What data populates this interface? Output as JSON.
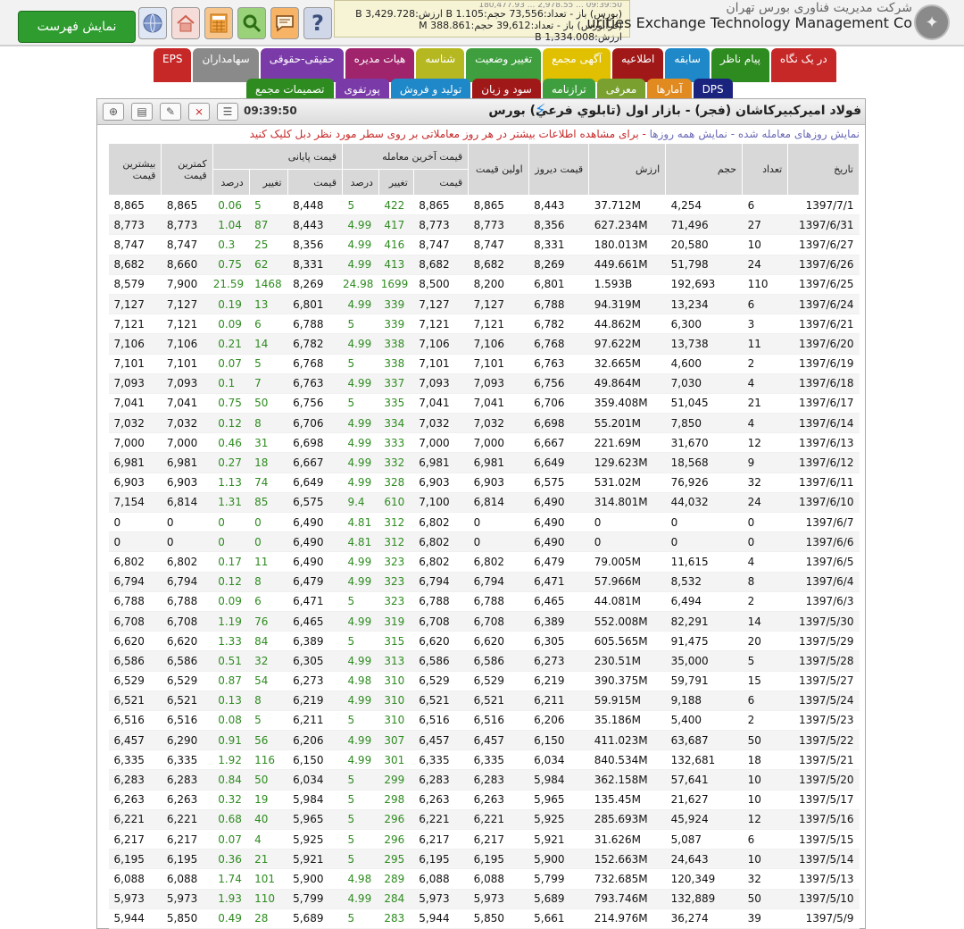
{
  "header": {
    "show_list_label": "نمایش فهرست",
    "company_fa": "شرکت مدیریت فناوری بورس تهران",
    "company_en": "urities Exchange Technology Management Co",
    "ticker_line_faint": "09:39:50 ... 2,978.55 ... 180,477.93",
    "ticker_line1": "(بورس) باز - تعداد:73,556 حجم:1.105 B ارزش:3,429.728 B",
    "ticker_line2": "(فرابورس) باز - تعداد:39,612 حجم:388.861 M ارزش:1,334.008 B",
    "icons": [
      "globe-icon",
      "home-icon",
      "calculator-icon",
      "search-icon",
      "message-icon",
      "help-icon"
    ]
  },
  "tabs_row1": [
    {
      "label": "در یک نگاه",
      "color": "#c62828"
    },
    {
      "label": "پیام ناظر",
      "color": "#2e8b20"
    },
    {
      "label": "سابقه",
      "color": "#1e88c8"
    },
    {
      "label": "اطلاعیه",
      "color": "#a01818"
    },
    {
      "label": "آگهی مجمع",
      "color": "#e0c000"
    },
    {
      "label": "تغییر وضعیت",
      "color": "#3f9f3f"
    },
    {
      "label": "شناسه",
      "color": "#b5b820"
    },
    {
      "label": "هیات مدیره",
      "color": "#a0246b"
    },
    {
      "label": "حقیقی-حقوقی",
      "color": "#7a3aa8"
    },
    {
      "label": "سهامداران",
      "color": "#8a8a8a"
    },
    {
      "label": "EPS",
      "color": "#c62828"
    }
  ],
  "tabs_row2": [
    {
      "label": "DPS",
      "color": "#1a237e"
    },
    {
      "label": "آمارها",
      "color": "#e08a20"
    },
    {
      "label": "معرفی",
      "color": "#7aa030"
    },
    {
      "label": "ترازنامه",
      "color": "#3f9f3f"
    },
    {
      "label": "سود و زیان",
      "color": "#a01818"
    },
    {
      "label": "تولید و فروش",
      "color": "#1e88c8"
    },
    {
      "label": "پورتفوی",
      "color": "#7a3aa8"
    },
    {
      "label": "تصمیمات مجمع",
      "color": "#2e8b20"
    }
  ],
  "panel": {
    "title": "فولاد اميركبيركاشان (فجر) - بازار اول (تابلوي فرعي) بورس",
    "time": "09:39:50",
    "notice_link1": "نمایش روزهای معامله شده",
    "notice_sep": " - ",
    "notice_link2": "نمایش همه روزها",
    "notice_msg": " - برای مشاهده اطلاعات بیشتر در هر روز معاملاتی بر روی سطر مورد نظر دبل کلیک کنید"
  },
  "table": {
    "headers": {
      "date": "تاریخ",
      "count": "تعداد",
      "volume": "حجم",
      "value": "ارزش",
      "yesterday": "قیمت دیروز",
      "first": "اولین قیمت",
      "last_group": "قیمت آخرین معامله",
      "final_group": "قیمت پایانی",
      "price": "قیمت",
      "change": "تغییر",
      "percent": "درصد",
      "min": "کمترین قیمت",
      "max": "بیشترین قیمت"
    },
    "rows": [
      [
        "1397/7/1",
        "6",
        "4,254",
        "37.712M",
        "8,443",
        "8,865",
        "8,865",
        "422",
        "5",
        "8,448",
        "5",
        "0.06",
        "8,865",
        "8,865"
      ],
      [
        "1397/6/31",
        "27",
        "71,496",
        "627.234M",
        "8,356",
        "8,773",
        "8,773",
        "417",
        "4.99",
        "8,443",
        "87",
        "1.04",
        "8,773",
        "8,773"
      ],
      [
        "1397/6/27",
        "10",
        "20,580",
        "180.013M",
        "8,331",
        "8,747",
        "8,747",
        "416",
        "4.99",
        "8,356",
        "25",
        "0.3",
        "8,747",
        "8,747"
      ],
      [
        "1397/6/26",
        "24",
        "51,798",
        "449.661M",
        "8,269",
        "8,682",
        "8,682",
        "413",
        "4.99",
        "8,331",
        "62",
        "0.75",
        "8,660",
        "8,682"
      ],
      [
        "1397/6/25",
        "110",
        "192,693",
        "1.593B",
        "6,801",
        "8,200",
        "8,500",
        "1699",
        "24.98",
        "8,269",
        "1468",
        "21.59",
        "7,900",
        "8,579"
      ],
      [
        "1397/6/24",
        "6",
        "13,234",
        "94.319M",
        "6,788",
        "7,127",
        "7,127",
        "339",
        "4.99",
        "6,801",
        "13",
        "0.19",
        "7,127",
        "7,127"
      ],
      [
        "1397/6/21",
        "3",
        "6,300",
        "44.862M",
        "6,782",
        "7,121",
        "7,121",
        "339",
        "5",
        "6,788",
        "6",
        "0.09",
        "7,121",
        "7,121"
      ],
      [
        "1397/6/20",
        "11",
        "13,738",
        "97.622M",
        "6,768",
        "7,106",
        "7,106",
        "338",
        "4.99",
        "6,782",
        "14",
        "0.21",
        "7,106",
        "7,106"
      ],
      [
        "1397/6/19",
        "2",
        "4,600",
        "32.665M",
        "6,763",
        "7,101",
        "7,101",
        "338",
        "5",
        "6,768",
        "5",
        "0.07",
        "7,101",
        "7,101"
      ],
      [
        "1397/6/18",
        "4",
        "7,030",
        "49.864M",
        "6,756",
        "7,093",
        "7,093",
        "337",
        "4.99",
        "6,763",
        "7",
        "0.1",
        "7,093",
        "7,093"
      ],
      [
        "1397/6/17",
        "21",
        "51,045",
        "359.408M",
        "6,706",
        "7,041",
        "7,041",
        "335",
        "5",
        "6,756",
        "50",
        "0.75",
        "7,041",
        "7,041"
      ],
      [
        "1397/6/14",
        "4",
        "7,850",
        "55.201M",
        "6,698",
        "7,032",
        "7,032",
        "334",
        "4.99",
        "6,706",
        "8",
        "0.12",
        "7,032",
        "7,032"
      ],
      [
        "1397/6/13",
        "12",
        "31,670",
        "221.69M",
        "6,667",
        "7,000",
        "7,000",
        "333",
        "4.99",
        "6,698",
        "31",
        "0.46",
        "7,000",
        "7,000"
      ],
      [
        "1397/6/12",
        "9",
        "18,568",
        "129.623M",
        "6,649",
        "6,981",
        "6,981",
        "332",
        "4.99",
        "6,667",
        "18",
        "0.27",
        "6,981",
        "6,981"
      ],
      [
        "1397/6/11",
        "32",
        "76,926",
        "531.02M",
        "6,575",
        "6,903",
        "6,903",
        "328",
        "4.99",
        "6,649",
        "74",
        "1.13",
        "6,903",
        "6,903"
      ],
      [
        "1397/6/10",
        "24",
        "44,032",
        "314.801M",
        "6,490",
        "6,814",
        "7,100",
        "610",
        "9.4",
        "6,575",
        "85",
        "1.31",
        "6,814",
        "7,154"
      ],
      [
        "1397/6/7",
        "0",
        "0",
        "0",
        "6,490",
        "0",
        "6,802",
        "312",
        "4.81",
        "6,490",
        "0",
        "0",
        "0",
        "0"
      ],
      [
        "1397/6/6",
        "0",
        "0",
        "0",
        "6,490",
        "0",
        "6,802",
        "312",
        "4.81",
        "6,490",
        "0",
        "0",
        "0",
        "0"
      ],
      [
        "1397/6/5",
        "4",
        "11,615",
        "79.005M",
        "6,479",
        "6,802",
        "6,802",
        "323",
        "4.99",
        "6,490",
        "11",
        "0.17",
        "6,802",
        "6,802"
      ],
      [
        "1397/6/4",
        "8",
        "8,532",
        "57.966M",
        "6,471",
        "6,794",
        "6,794",
        "323",
        "4.99",
        "6,479",
        "8",
        "0.12",
        "6,794",
        "6,794"
      ],
      [
        "1397/6/3",
        "2",
        "6,494",
        "44.081M",
        "6,465",
        "6,788",
        "6,788",
        "323",
        "5",
        "6,471",
        "6",
        "0.09",
        "6,788",
        "6,788"
      ],
      [
        "1397/5/30",
        "14",
        "82,291",
        "552.008M",
        "6,389",
        "6,708",
        "6,708",
        "319",
        "4.99",
        "6,465",
        "76",
        "1.19",
        "6,708",
        "6,708"
      ],
      [
        "1397/5/29",
        "20",
        "91,475",
        "605.565M",
        "6,305",
        "6,620",
        "6,620",
        "315",
        "5",
        "6,389",
        "84",
        "1.33",
        "6,620",
        "6,620"
      ],
      [
        "1397/5/28",
        "5",
        "35,000",
        "230.51M",
        "6,273",
        "6,586",
        "6,586",
        "313",
        "4.99",
        "6,305",
        "32",
        "0.51",
        "6,586",
        "6,586"
      ],
      [
        "1397/5/27",
        "15",
        "59,791",
        "390.375M",
        "6,219",
        "6,529",
        "6,529",
        "310",
        "4.98",
        "6,273",
        "54",
        "0.87",
        "6,529",
        "6,529"
      ],
      [
        "1397/5/24",
        "6",
        "9,188",
        "59.915M",
        "6,211",
        "6,521",
        "6,521",
        "310",
        "4.99",
        "6,219",
        "8",
        "0.13",
        "6,521",
        "6,521"
      ],
      [
        "1397/5/23",
        "2",
        "5,400",
        "35.186M",
        "6,206",
        "6,516",
        "6,516",
        "310",
        "5",
        "6,211",
        "5",
        "0.08",
        "6,516",
        "6,516"
      ],
      [
        "1397/5/22",
        "50",
        "63,687",
        "411.023M",
        "6,150",
        "6,457",
        "6,457",
        "307",
        "4.99",
        "6,206",
        "56",
        "0.91",
        "6,290",
        "6,457"
      ],
      [
        "1397/5/21",
        "18",
        "132,681",
        "840.534M",
        "6,034",
        "6,335",
        "6,335",
        "301",
        "4.99",
        "6,150",
        "116",
        "1.92",
        "6,335",
        "6,335"
      ],
      [
        "1397/5/20",
        "10",
        "57,641",
        "362.158M",
        "5,984",
        "6,283",
        "6,283",
        "299",
        "5",
        "6,034",
        "50",
        "0.84",
        "6,283",
        "6,283"
      ],
      [
        "1397/5/17",
        "10",
        "21,627",
        "135.45M",
        "5,965",
        "6,263",
        "6,263",
        "298",
        "5",
        "5,984",
        "19",
        "0.32",
        "6,263",
        "6,263"
      ],
      [
        "1397/5/16",
        "12",
        "45,924",
        "285.693M",
        "5,925",
        "6,221",
        "6,221",
        "296",
        "5",
        "5,965",
        "40",
        "0.68",
        "6,221",
        "6,221"
      ],
      [
        "1397/5/15",
        "6",
        "5,087",
        "31.626M",
        "5,921",
        "6,217",
        "6,217",
        "296",
        "5",
        "5,925",
        "4",
        "0.07",
        "6,217",
        "6,217"
      ],
      [
        "1397/5/14",
        "10",
        "24,643",
        "152.663M",
        "5,900",
        "6,195",
        "6,195",
        "295",
        "5",
        "5,921",
        "21",
        "0.36",
        "6,195",
        "6,195"
      ],
      [
        "1397/5/13",
        "32",
        "120,349",
        "732.685M",
        "5,799",
        "6,088",
        "6,088",
        "289",
        "4.98",
        "5,900",
        "101",
        "1.74",
        "6,088",
        "6,088"
      ],
      [
        "1397/5/10",
        "50",
        "132,889",
        "793.746M",
        "5,689",
        "5,973",
        "5,973",
        "284",
        "4.99",
        "5,799",
        "110",
        "1.93",
        "5,973",
        "5,973"
      ],
      [
        "1397/5/9",
        "39",
        "36,274",
        "214.976M",
        "5,661",
        "5,850",
        "5,944",
        "283",
        "5",
        "5,689",
        "28",
        "0.49",
        "5,850",
        "5,944"
      ]
    ]
  }
}
